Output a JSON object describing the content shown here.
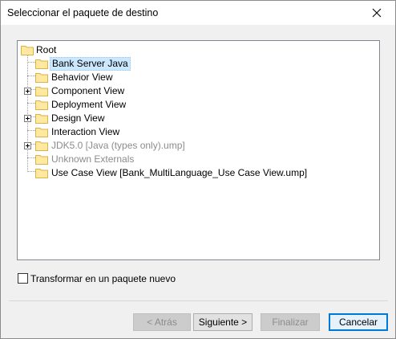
{
  "window": {
    "title": "Seleccionar el paquete de destino"
  },
  "tree": {
    "root_label": "Root",
    "items": [
      {
        "label": "Bank Server Java",
        "expandable": false,
        "selected": true,
        "disabled": false
      },
      {
        "label": "Behavior View",
        "expandable": false,
        "selected": false,
        "disabled": false
      },
      {
        "label": "Component View",
        "expandable": true,
        "selected": false,
        "disabled": false
      },
      {
        "label": "Deployment View",
        "expandable": false,
        "selected": false,
        "disabled": false
      },
      {
        "label": "Design View",
        "expandable": true,
        "selected": false,
        "disabled": false
      },
      {
        "label": "Interaction View",
        "expandable": false,
        "selected": false,
        "disabled": false
      },
      {
        "label": "JDK5.0 [Java (types only).ump]",
        "expandable": true,
        "selected": false,
        "disabled": true
      },
      {
        "label": "Unknown Externals",
        "expandable": false,
        "selected": false,
        "disabled": true
      },
      {
        "label": "Use Case View [Bank_MultiLanguage_Use Case View.ump]",
        "expandable": false,
        "selected": false,
        "disabled": false
      }
    ]
  },
  "options": {
    "transform_label": "Transformar en un paquete nuevo",
    "transform_checked": false
  },
  "buttons": {
    "back_label": "< Atrás",
    "next_label": "Siguiente >",
    "finish_label": "Finalizar",
    "cancel_label": "Cancelar"
  },
  "icons": {
    "folder": "folder-icon",
    "close": "close-icon",
    "expand": "plus-expander-icon"
  },
  "colors": {
    "folder_fill": "#ffe9a0",
    "folder_stroke": "#d8b24a",
    "selection": "#cce8ff",
    "disabled_text": "#8c8c8c",
    "primary_border": "#0078d7"
  }
}
